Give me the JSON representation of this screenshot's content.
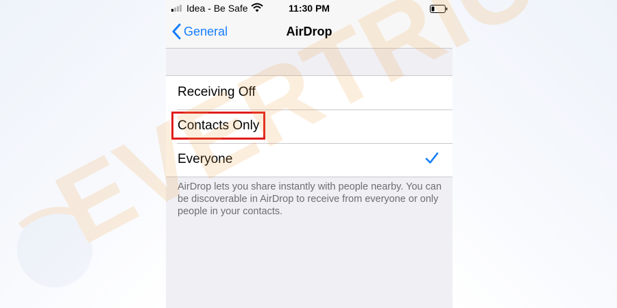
{
  "status_bar": {
    "carrier": "Idea - Be Safe",
    "time": "11:30 PM",
    "signal_bars_filled": 1,
    "signal_bars_total": 4,
    "icons": [
      "signal-icon",
      "wifi-icon",
      "battery-icon"
    ]
  },
  "nav": {
    "back_label": "General",
    "title": "AirDrop",
    "back_icon": "chevron-left-icon"
  },
  "options": [
    {
      "label": "Receiving Off",
      "selected": false,
      "highlighted": false
    },
    {
      "label": "Contacts Only",
      "selected": false,
      "highlighted": true
    },
    {
      "label": "Everyone",
      "selected": true,
      "highlighted": false
    }
  ],
  "footer_note": "AirDrop lets you share instantly with people nearby. You can be discoverable in AirDrop to receive from everyone or only people in your contacts.",
  "colors": {
    "accent": "#157efb",
    "highlight": "#e01b1b",
    "watermark": "#f5c98a"
  },
  "watermark_text": "EVERTRICKS"
}
